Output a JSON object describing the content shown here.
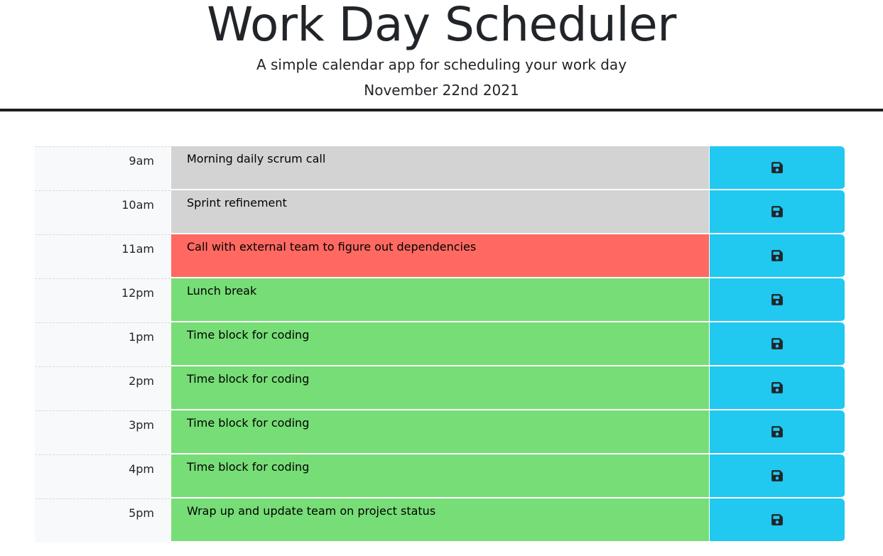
{
  "header": {
    "title": "Work Day Scheduler",
    "subtitle": "A simple calendar app for scheduling your work day",
    "date": "November 22nd 2021"
  },
  "colors": {
    "past": "#d3d3d3",
    "present": "#ff6961",
    "future": "#77dd77",
    "save": "#21c8ef"
  },
  "rows": [
    {
      "hour": "9am",
      "text": "Morning daily scrum call",
      "state": "past",
      "save_icon": "floppy-disk-icon"
    },
    {
      "hour": "10am",
      "text": "Sprint refinement",
      "state": "past",
      "save_icon": "floppy-disk-icon"
    },
    {
      "hour": "11am",
      "text": "Call with external team to figure out dependencies",
      "state": "present",
      "save_icon": "floppy-disk-icon"
    },
    {
      "hour": "12pm",
      "text": "Lunch break",
      "state": "future",
      "save_icon": "floppy-disk-icon"
    },
    {
      "hour": "1pm",
      "text": "Time block for coding",
      "state": "future",
      "save_icon": "floppy-disk-icon"
    },
    {
      "hour": "2pm",
      "text": "Time block for coding",
      "state": "future",
      "save_icon": "floppy-disk-icon"
    },
    {
      "hour": "3pm",
      "text": "Time block for coding",
      "state": "future",
      "save_icon": "floppy-disk-icon"
    },
    {
      "hour": "4pm",
      "text": "Time block for coding",
      "state": "future",
      "save_icon": "floppy-disk-icon"
    },
    {
      "hour": "5pm",
      "text": "Wrap up and update team on project status",
      "state": "future",
      "save_icon": "floppy-disk-icon"
    }
  ]
}
